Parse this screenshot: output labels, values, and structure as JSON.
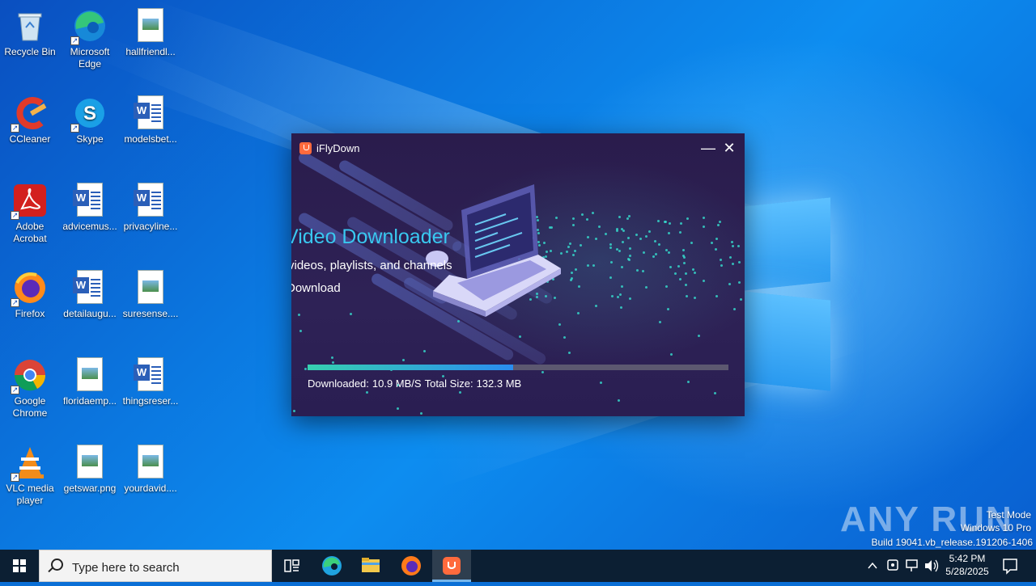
{
  "desktop": {
    "icons": [
      {
        "label": "Recycle Bin",
        "icon": "recycle-bin-icon"
      },
      {
        "label": "Microsoft Edge",
        "icon": "edge-icon"
      },
      {
        "label": "hallfriendl...",
        "icon": "image-file-icon"
      },
      {
        "label": "CCleaner",
        "icon": "ccleaner-icon"
      },
      {
        "label": "Skype",
        "icon": "skype-icon"
      },
      {
        "label": "modelsbet...",
        "icon": "word-doc-icon"
      },
      {
        "label": "Adobe Acrobat",
        "icon": "acrobat-icon"
      },
      {
        "label": "advicemus...",
        "icon": "word-doc-icon"
      },
      {
        "label": "privacyline...",
        "icon": "word-doc-icon"
      },
      {
        "label": "Firefox",
        "icon": "firefox-icon"
      },
      {
        "label": "detailaugu...",
        "icon": "word-doc-icon"
      },
      {
        "label": "suresense....",
        "icon": "image-file-icon"
      },
      {
        "label": "Google Chrome",
        "icon": "chrome-icon"
      },
      {
        "label": "floridaemp...",
        "icon": "image-file-icon"
      },
      {
        "label": "thingsreser...",
        "icon": "word-doc-icon"
      },
      {
        "label": "VLC media player",
        "icon": "vlc-icon"
      },
      {
        "label": "getswar.png",
        "icon": "image-file-icon"
      },
      {
        "label": "yourdavid....",
        "icon": "image-file-icon"
      }
    ]
  },
  "window": {
    "title": "iFlyDown",
    "minimize": "—",
    "close": "✕",
    "hero_title": "Video Downloader",
    "hero_sub": "videos, playlists, and channels",
    "hero_action": "Download",
    "progress_fraction": 0.489,
    "status_downloaded_label": "Downloaded:",
    "status_speed": "10.9 MB/S",
    "status_total_label": "Total Size:",
    "status_total": "132.3 MB"
  },
  "watermark": {
    "brand": "ANY RUN",
    "mode": "Test Mode",
    "os": "Windows 10 Pro",
    "build": "Build 19041.vb_release.191206-1406"
  },
  "taskbar": {
    "search_placeholder": "Type here to search",
    "time": "5:42 PM",
    "date": "5/28/2025"
  },
  "colors": {
    "accent": "#39c8f0",
    "progress_start": "#36d0b0",
    "progress_end": "#2a8cf0",
    "window_bg": "#2a1f4e"
  }
}
